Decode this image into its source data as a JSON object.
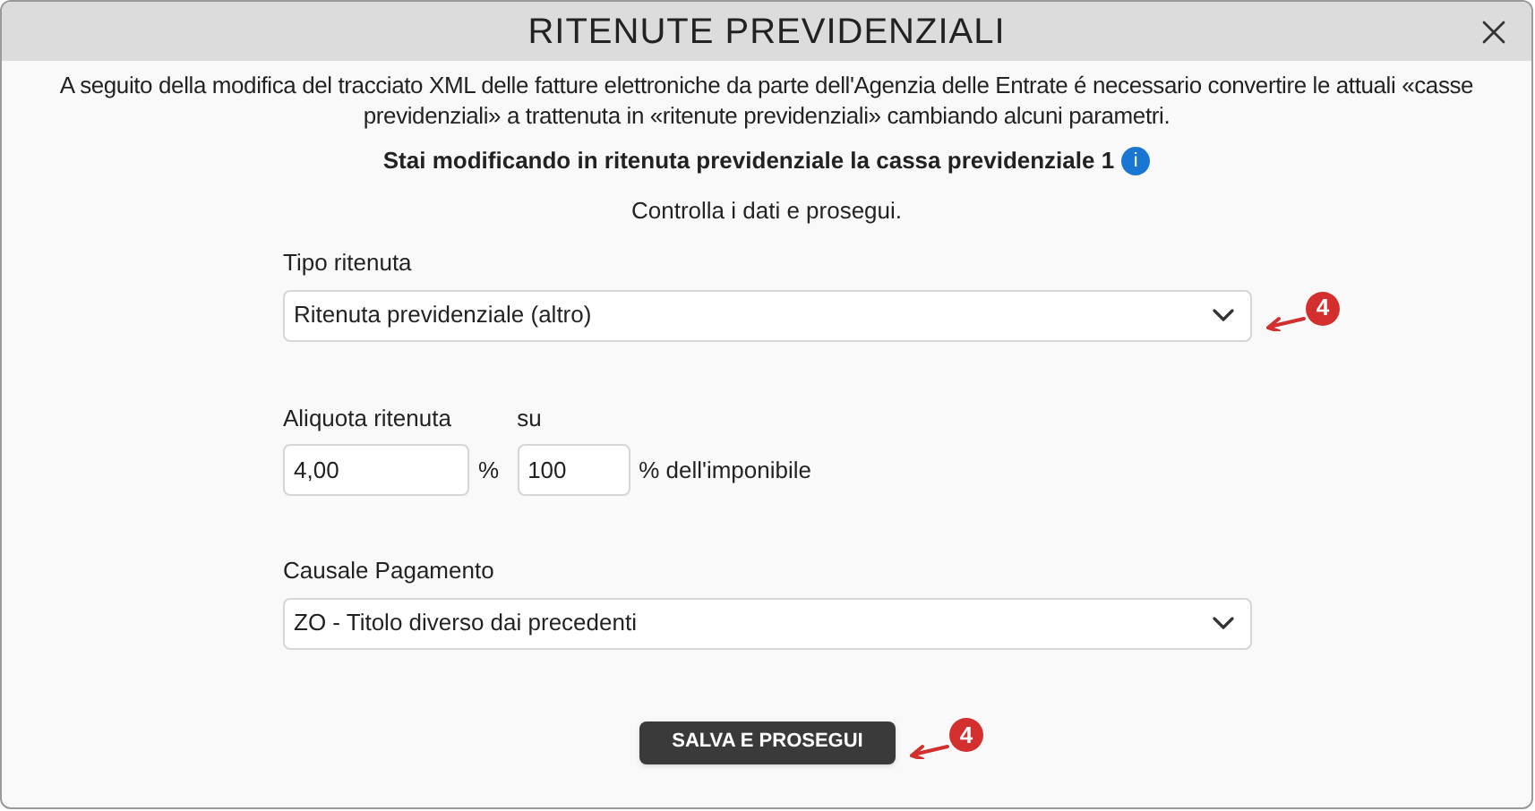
{
  "window": {
    "title": "RITENUTE PREVIDENZIALI"
  },
  "intro": "A seguito della modifica del tracciato XML delle fatture elettroniche da parte dell'Agenzia delle Entrate é necessario convertire le attuali «casse previdenziali» a trattenuta in «ritenute previdenziali» cambiando alcuni parametri.",
  "heading": "Stai modificando in ritenuta previdenziale la cassa previdenziale 1",
  "info_icon": "i",
  "instruction": "Controlla i dati e prosegui.",
  "tipo": {
    "label": "Tipo ritenuta",
    "value": "Ritenuta previdenziale (altro)",
    "callout": "4"
  },
  "aliquota": {
    "label": "Aliquota ritenuta",
    "value": "4,00",
    "unit": "%"
  },
  "base": {
    "label": "su",
    "value": "100",
    "unit": "% dell'imponibile"
  },
  "causale": {
    "label": "Causale Pagamento",
    "value": "ZO - Titolo diverso dai precedenti"
  },
  "save_button": {
    "label": "SALVA E PROSEGUI",
    "callout": "4"
  }
}
